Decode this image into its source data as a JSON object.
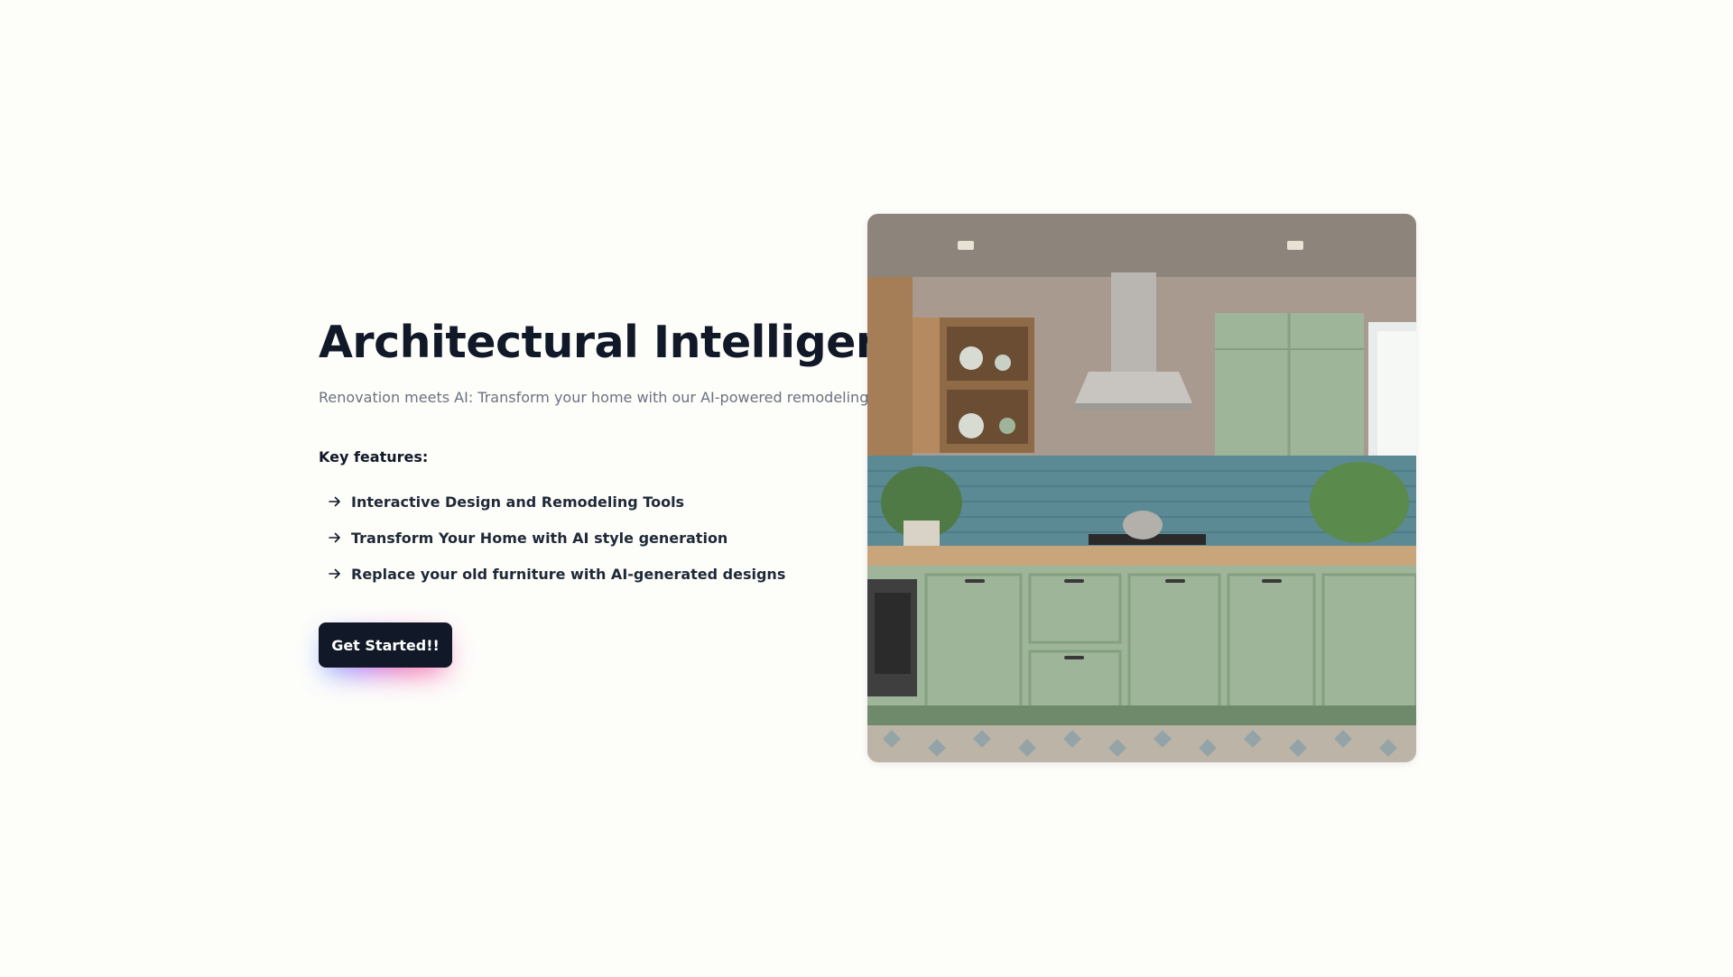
{
  "hero": {
    "title": "Architectural Intelligence",
    "subtitle": "Renovation meets AI: Transform your home with our AI-powered remodeling tool.",
    "features_heading": "Key features:",
    "features": [
      "Interactive Design and Remodeling Tools",
      "Transform Your Home with AI style generation",
      "Replace your old furniture with AI-generated designs"
    ],
    "cta_label": "Get Started!!",
    "image_alt": "kitchen-photo"
  },
  "colors": {
    "background": "#fdfdfa",
    "title": "#111827",
    "subtitle": "#6b7280",
    "button": "#111827",
    "button_text": "#ffffff",
    "cabinet_green": "#9fb59a",
    "tile_blue": "#5b8a94"
  }
}
